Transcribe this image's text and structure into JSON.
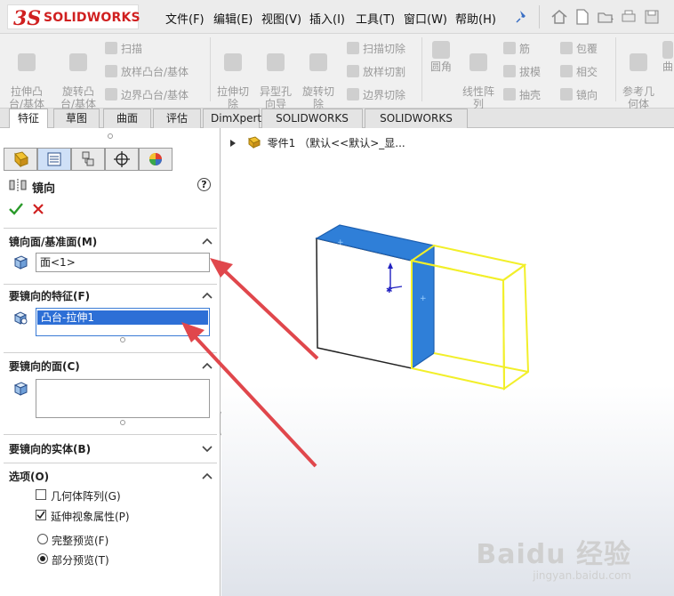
{
  "app": {
    "logo_ds": "3S",
    "logo_text": "SOLIDWORKS"
  },
  "menu": [
    {
      "label": "文件(F)"
    },
    {
      "label": "编辑(E)"
    },
    {
      "label": "视图(V)"
    },
    {
      "label": "插入(I)"
    },
    {
      "label": "工具(T)"
    },
    {
      "label": "窗口(W)"
    },
    {
      "label": "帮助(H)"
    }
  ],
  "ribbon": {
    "extrude_boss": "拉伸凸\n台/基体",
    "revolve_boss": "旋转凸\n台/基体",
    "sweep": "扫描",
    "loft_boss": "放样凸台/基体",
    "boundary_boss": "边界凸台/基体",
    "extrude_cut": "拉伸切\n除",
    "hole_wizard": "异型孔\n向导",
    "revolve_cut": "旋转切\n除",
    "sweep_cut": "扫描切除",
    "loft_cut": "放样切割",
    "boundary_cut": "边界切除",
    "fillet": "圆角",
    "linear_pattern": "线性阵\n列",
    "rib": "筋",
    "draft": "拔模",
    "shell": "抽壳",
    "wrap": "包覆",
    "intersect": "相交",
    "mirror": "镜向",
    "reference_geometry": "参考几\n何体",
    "curves": "曲"
  },
  "tabs": [
    {
      "label": "特征",
      "active": true
    },
    {
      "label": "草图"
    },
    {
      "label": "曲面"
    },
    {
      "label": "评估"
    },
    {
      "label": "DimXpert"
    },
    {
      "label": "SOLIDWORKS 插件"
    },
    {
      "label": "SOLIDWORKS MBD"
    }
  ],
  "panel": {
    "title": "镜向",
    "help": "?",
    "mirror_face": {
      "header": "镜向面/基准面(M)",
      "value": "面<1>"
    },
    "features": {
      "header": "要镜向的特征(F)",
      "value": "凸台-拉伸1"
    },
    "faces": {
      "header": "要镜向的面(C)",
      "value": ""
    },
    "bodies": {
      "header": "要镜向的实体(B)"
    },
    "options": {
      "header": "选项(O)",
      "geometry_pattern": {
        "label": "几何体阵列(G)",
        "checked": false
      },
      "propagate_visual": {
        "label": "延伸视象属性(P)",
        "checked": true
      },
      "full_preview": {
        "label": "完整预览(F)",
        "selected": false
      },
      "partial_preview": {
        "label": "部分预览(T)",
        "selected": true
      }
    }
  },
  "tree": {
    "label": "零件1 （默认<<默认>_显..."
  },
  "watermark": {
    "brand": "Baidu 经验",
    "url": "jingyan.baidu.com"
  },
  "colors": {
    "selected_face": "#2f7fd8",
    "preview": "#f2ef2a",
    "arrow": "#e0474c",
    "accent_red": "#d02020"
  }
}
